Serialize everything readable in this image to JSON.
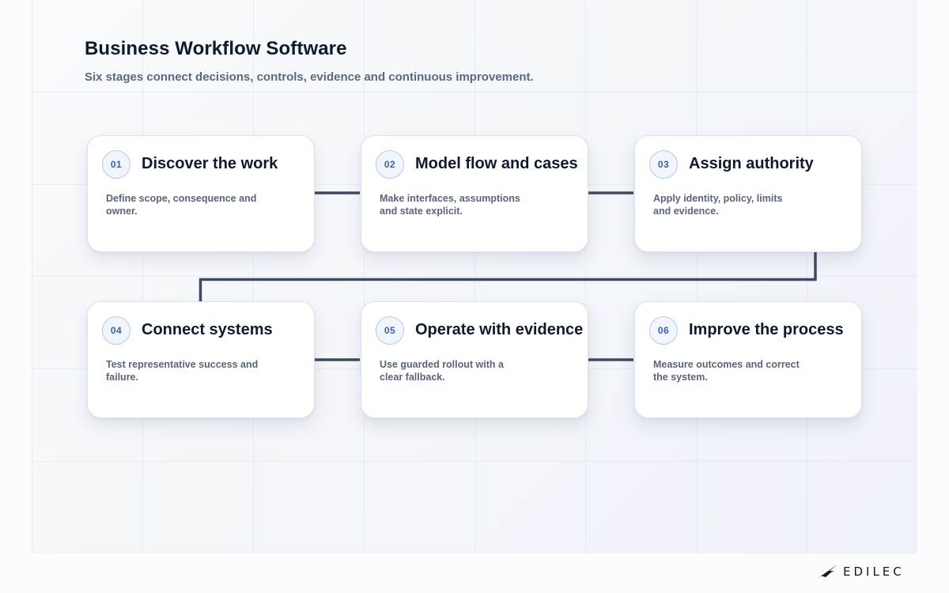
{
  "header": {
    "title": "Business Workflow Software",
    "subtitle": "Six stages connect decisions, controls, evidence and continuous improvement."
  },
  "stages": [
    {
      "number": "01",
      "title": "Discover the work",
      "description": "Define scope, consequence and owner."
    },
    {
      "number": "02",
      "title": "Model flow and cases",
      "description": "Make interfaces, assumptions and state explicit."
    },
    {
      "number": "03",
      "title": "Assign authority",
      "description": "Apply identity, policy, limits and evidence."
    },
    {
      "number": "04",
      "title": "Connect systems",
      "description": "Test representative success and failure."
    },
    {
      "number": "05",
      "title": "Operate with evidence",
      "description": "Use guarded rollout with a clear fallback."
    },
    {
      "number": "06",
      "title": "Improve the process",
      "description": "Measure outcomes and correct the system."
    }
  ],
  "brand": {
    "logo_text": "EDILEC",
    "logo_icon": "bird-wing-icon"
  },
  "colors": {
    "connector": "#3f4b5e",
    "badge_text": "#3d5fb0",
    "badge_border": "#b9c9ec",
    "title": "#101a2c",
    "description": "#5a6578"
  }
}
